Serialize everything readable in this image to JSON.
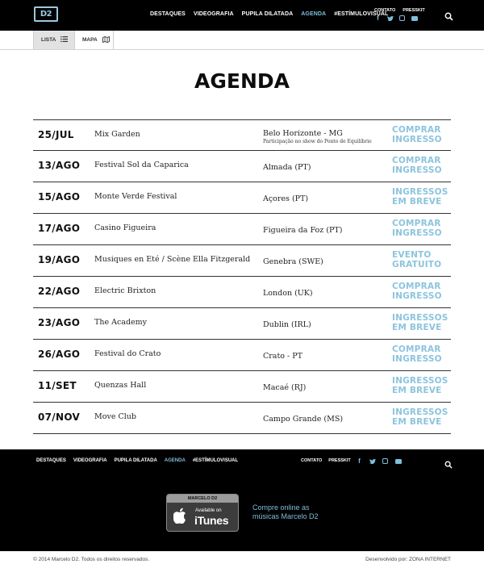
{
  "header": {
    "logo_text": "D2",
    "nav": [
      {
        "label": "Destaques",
        "active": false
      },
      {
        "label": "Videografia",
        "active": false
      },
      {
        "label": "Pupila Dilatada",
        "active": false
      },
      {
        "label": "Agenda",
        "active": true
      },
      {
        "label": "#Estímulovisual",
        "active": false
      }
    ],
    "utility": [
      "Contato",
      "Presskit"
    ],
    "socials": [
      "facebook-icon",
      "twitter-icon",
      "instagram-icon",
      "youtube-icon"
    ]
  },
  "view_tabs": {
    "lista": "Lista",
    "mapa": "Mapa",
    "selected": "Lista"
  },
  "page_title": "AGENDA",
  "events": [
    {
      "date": "25/JUL",
      "venue": "Mix Garden",
      "city": "Belo Horizonte - MG",
      "note": "Participação no show do Ponto de Equilíbrio",
      "action": [
        "COMPRAR",
        "INGRESSO"
      ]
    },
    {
      "date": "13/AGO",
      "venue": "Festival Sol da Caparica",
      "city": "Almada (PT)",
      "note": "",
      "action": [
        "COMPRAR",
        "INGRESSO"
      ]
    },
    {
      "date": "15/AGO",
      "venue": "Monte Verde Festival",
      "city": "Açores (PT)",
      "note": "",
      "action": [
        "INGRESSOS",
        "EM BREVE"
      ]
    },
    {
      "date": "17/AGO",
      "venue": "Casino Figueira",
      "city": "Figueira da Foz (PT)",
      "note": "",
      "action": [
        "COMPRAR",
        "INGRESSO"
      ]
    },
    {
      "date": "19/AGO",
      "venue": "Musiques en Eté / Scène Ella Fitzgerald",
      "city": "Genebra (SWE)",
      "note": "",
      "action": [
        "EVENTO",
        "GRATUITO"
      ]
    },
    {
      "date": "22/AGO",
      "venue": "Electric Brixton",
      "city": "London (UK)",
      "note": "",
      "action": [
        "COMPRAR",
        "INGRESSO"
      ]
    },
    {
      "date": "23/AGO",
      "venue": "The Academy",
      "city": "Dublin (IRL)",
      "note": "",
      "action": [
        "INGRESSOS",
        "EM BREVE"
      ]
    },
    {
      "date": "26/AGO",
      "venue": "Festival do Crato",
      "city": "Crato - PT",
      "note": "",
      "action": [
        "COMPRAR",
        "INGRESSO"
      ]
    },
    {
      "date": "11/SET",
      "venue": "Quenzas Hall",
      "city": "Macaé (RJ)",
      "note": "",
      "action": [
        "INGRESSOS",
        "EM BREVE"
      ]
    },
    {
      "date": "07/NOV",
      "venue": "Move Club",
      "city": "Campo Grande (MS)",
      "note": "",
      "action": [
        "INGRESSOS",
        "EM BREVE"
      ]
    }
  ],
  "footer": {
    "nav": [
      {
        "label": "Destaques",
        "active": false
      },
      {
        "label": "Videografia",
        "active": false
      },
      {
        "label": "Pupila Dilatada",
        "active": false
      },
      {
        "label": "Agenda",
        "active": true
      },
      {
        "label": "#Estímulovisual",
        "active": false
      }
    ],
    "utility": [
      "Contato",
      "Presskit"
    ],
    "socials": [
      "facebook-icon",
      "twitter-icon",
      "instagram-icon",
      "youtube-icon"
    ],
    "itunes_badge": {
      "top": "MARCELO D2",
      "available": "Available on",
      "brand": "iTunes"
    },
    "buy_text": "Compre online as músicas Marcelo D2",
    "copyright": "© 2014 Marcelo D2. Todos os direitos reservados.",
    "credit": "Desenvolvido por: ZONA INTERNET"
  },
  "colors": {
    "accent": "#7fbfdc",
    "action": "#8cc4de",
    "dark": "#000000"
  }
}
